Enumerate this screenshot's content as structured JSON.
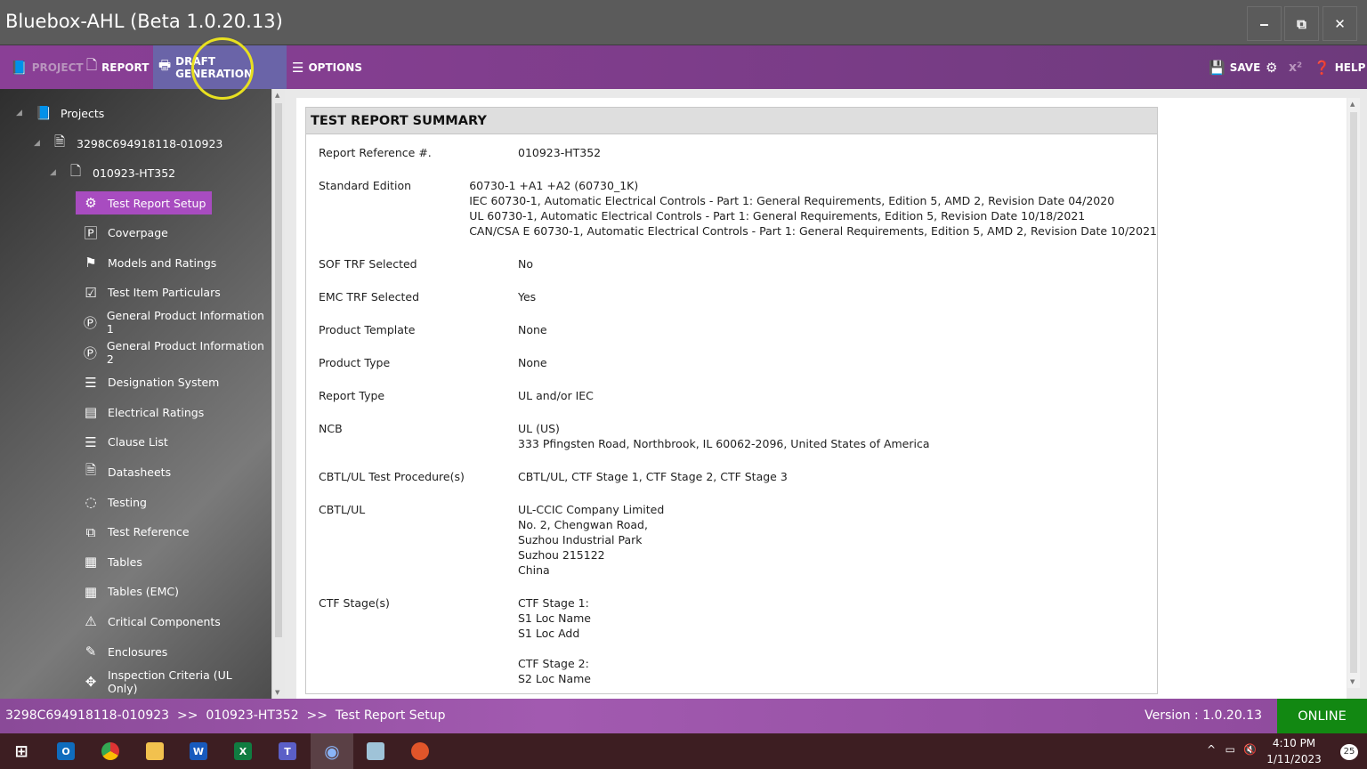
{
  "window": {
    "title": "Bluebox-AHL (Beta 1.0.20.13)",
    "minimize": "‒",
    "restore": "⧉",
    "close": "✕"
  },
  "menu": {
    "project": "PROJECT",
    "report": "REPORT",
    "draft": "DRAFT GENERATION",
    "options": "OPTIONS",
    "save": "SAVE",
    "superscript": "x²",
    "help": "HELP"
  },
  "tree": {
    "root": "Projects",
    "project": "3298C694918118-010923",
    "report": "010923-HT352",
    "items": [
      {
        "label": "Test Report Setup",
        "icon": "⚙"
      },
      {
        "label": "Coverpage",
        "icon": "🄿"
      },
      {
        "label": "Models and Ratings",
        "icon": "⚑"
      },
      {
        "label": "Test Item Particulars",
        "icon": "☑"
      },
      {
        "label": "General Product Information 1",
        "icon": "Ⓟ"
      },
      {
        "label": "General Product Information 2",
        "icon": "Ⓟ"
      },
      {
        "label": "Designation System",
        "icon": "☰"
      },
      {
        "label": "Electrical Ratings",
        "icon": "▤"
      },
      {
        "label": "Clause List",
        "icon": "☰"
      },
      {
        "label": "Datasheets",
        "icon": "🗎"
      },
      {
        "label": "Testing",
        "icon": "◌"
      },
      {
        "label": "Test Reference",
        "icon": "⧉"
      },
      {
        "label": "Tables",
        "icon": "▦"
      },
      {
        "label": "Tables (EMC)",
        "icon": "▦"
      },
      {
        "label": "Critical Components",
        "icon": "⚠"
      },
      {
        "label": "Enclosures",
        "icon": "✎"
      },
      {
        "label": "Inspection Criteria  (UL Only)",
        "icon": "✥"
      }
    ]
  },
  "summary": {
    "title": "TEST REPORT SUMMARY",
    "rows": [
      {
        "label": "Report Reference #.",
        "lines": [
          "010923-HT352"
        ]
      },
      {
        "label": "Standard Edition",
        "lines": [
          "60730-1 +A1 +A2 (60730_1K)",
          "IEC 60730-1, Automatic Electrical Controls - Part 1: General Requirements, Edition 5, AMD 2, Revision Date 04/2020",
          "UL 60730-1, Automatic Electrical Controls - Part 1: General Requirements, Edition 5, Revision Date 10/18/2021",
          "CAN/CSA E 60730-1, Automatic Electrical Controls - Part 1: General Requirements, Edition 5, AMD 2, Revision Date 10/2021"
        ]
      },
      {
        "label": "SOF TRF Selected",
        "lines": [
          "No"
        ]
      },
      {
        "label": "EMC TRF Selected",
        "lines": [
          "Yes"
        ]
      },
      {
        "label": "Product Template",
        "lines": [
          "None"
        ]
      },
      {
        "label": "Product Type",
        "lines": [
          "None"
        ]
      },
      {
        "label": "Report Type",
        "lines": [
          "UL and/or IEC"
        ]
      },
      {
        "label": "NCB",
        "lines": [
          "UL (US)",
          "333 Pfingsten Road, Northbrook, IL 60062-2096, United States of America"
        ]
      },
      {
        "label": "CBTL/UL Test Procedure(s)",
        "lines": [
          "CBTL/UL, CTF Stage 1, CTF Stage 2, CTF Stage 3"
        ]
      },
      {
        "label": "CBTL/UL",
        "lines": [
          "UL-CCIC Company Limited",
          "No. 2, Chengwan Road,",
          "Suzhou Industrial Park",
          "Suzhou 215122",
          "China"
        ]
      },
      {
        "label": "CTF Stage(s)",
        "lines": [
          "CTF Stage 1:",
          "S1 Loc Name",
          "S1 Loc Add",
          " ",
          "CTF Stage 2:",
          "S2 Loc Name"
        ]
      }
    ]
  },
  "status": {
    "breadcrumb": "3298C694918118-010923  >>  010923-HT352  >>  Test Report Setup",
    "version": "Version : 1.0.20.13",
    "online": "ONLINE"
  },
  "taskbar": {
    "time": "4:10 PM",
    "date": "1/11/2023",
    "notifications": "25"
  }
}
